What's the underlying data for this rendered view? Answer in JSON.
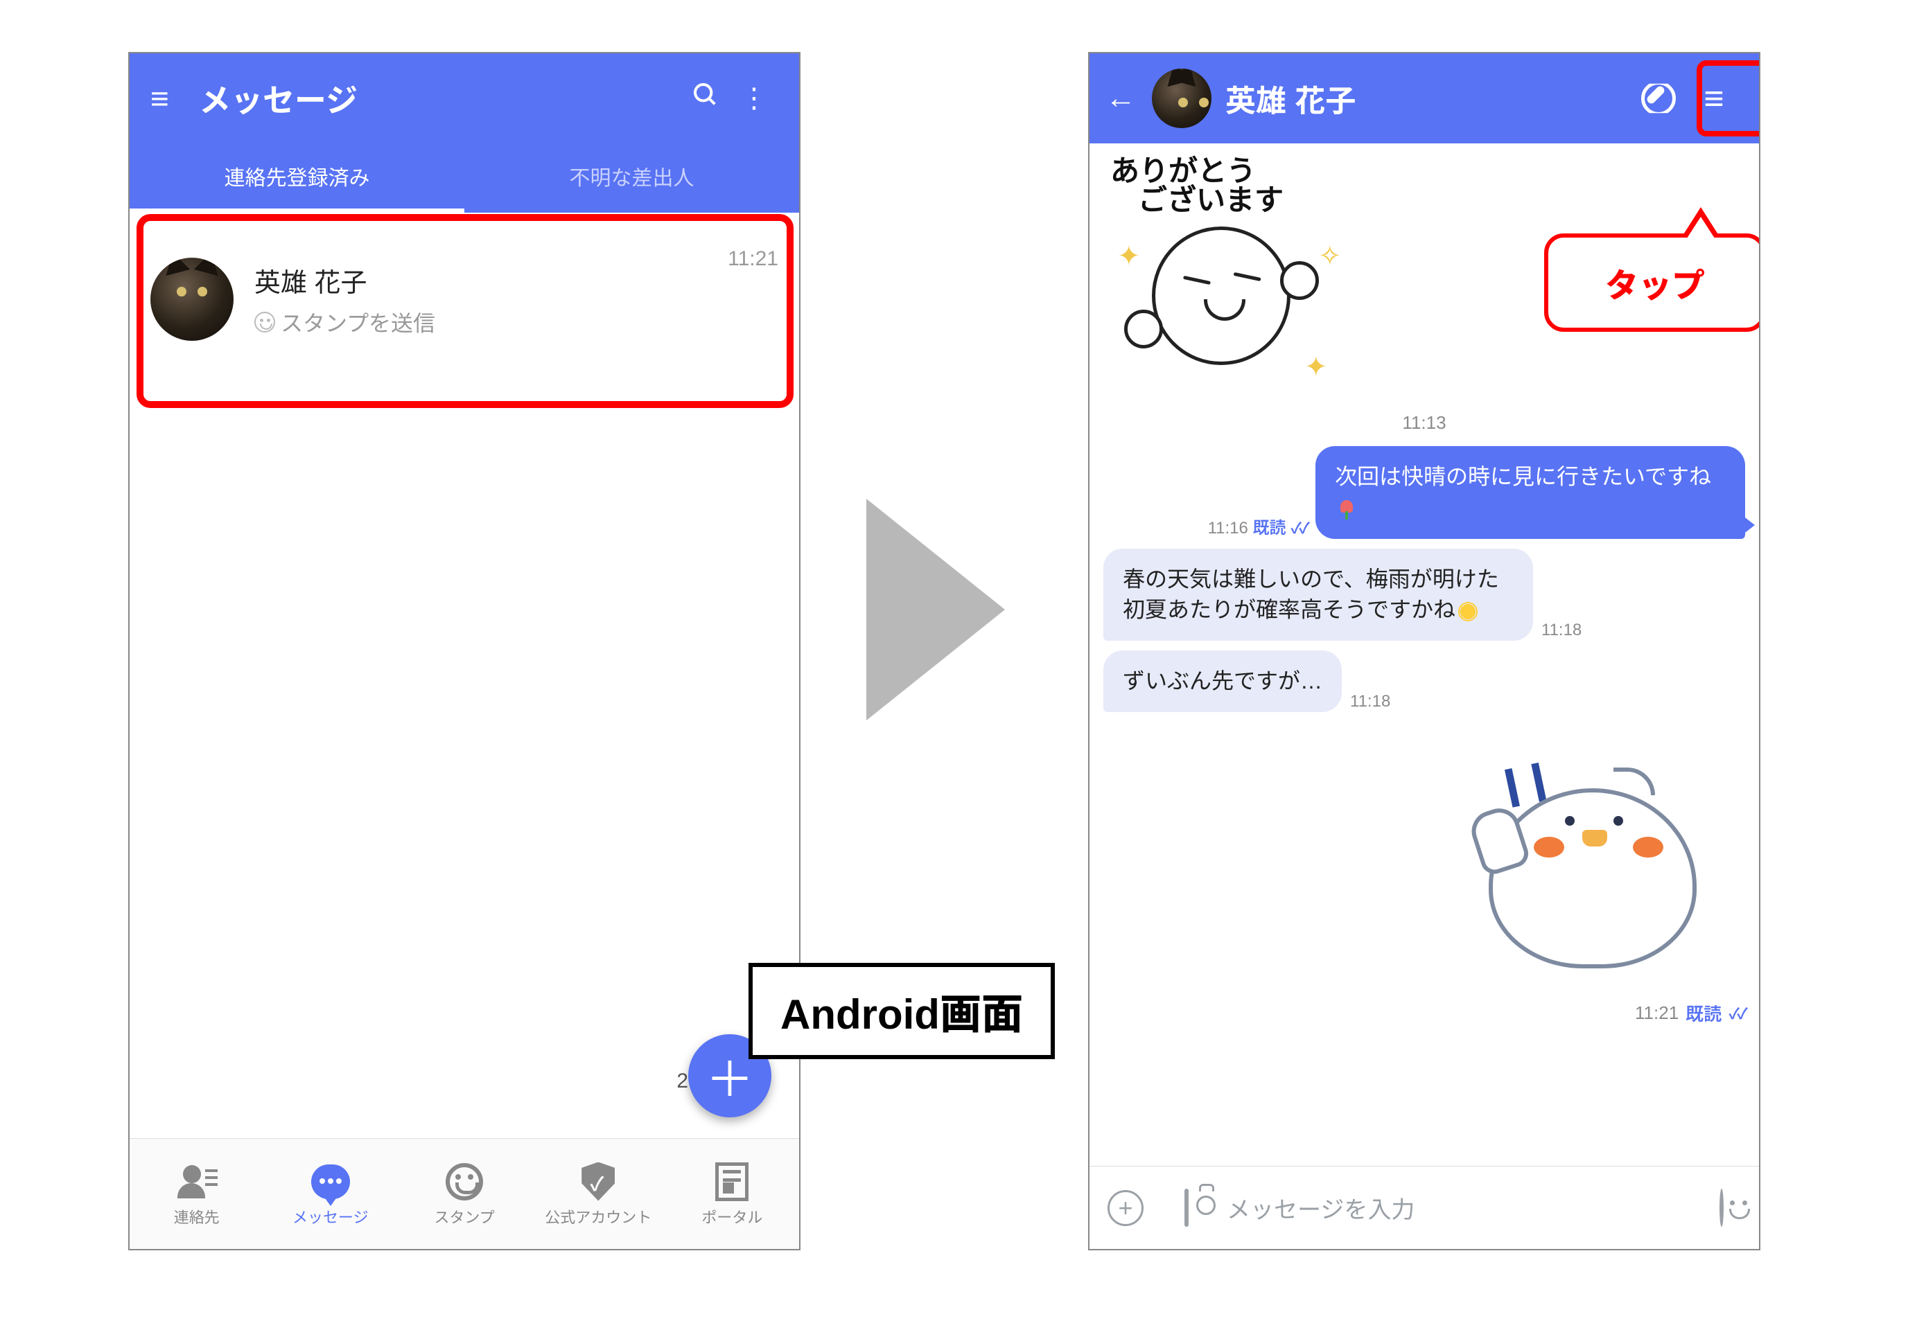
{
  "left": {
    "header": {
      "title": "メッセージ"
    },
    "tabs": {
      "registered": "連絡先登録済み",
      "unknown": "不明な差出人"
    },
    "conversation": {
      "name": "英雄 花子",
      "subtitle": "スタンプを送信",
      "time": "11:21"
    },
    "fab_badge": "2",
    "bottom_nav": {
      "contacts": "連絡先",
      "messages": "メッセージ",
      "stamps": "スタンプ",
      "official": "公式アカウント",
      "portal": "ポータル"
    }
  },
  "arrow_label": "Android画面",
  "callout": "タップ",
  "right": {
    "header": {
      "name": "英雄 花子"
    },
    "sticker1_line1": "ありがとう",
    "sticker1_line2": "ございます",
    "time1": "11:13",
    "msg_out": {
      "time": "11:16",
      "read": "既読",
      "text": "次回は快晴の時に見に行きたいですね"
    },
    "msg_in1": {
      "text": "春の天気は難しいので、梅雨が明けた初夏あたりが確率高そうですかね",
      "time": "11:18"
    },
    "msg_in2": {
      "text": "ずいぶん先ですが…",
      "time": "11:18"
    },
    "stamp2_meta": {
      "time": "11:21",
      "read": "既読"
    },
    "input_placeholder": "メッセージを入力"
  }
}
